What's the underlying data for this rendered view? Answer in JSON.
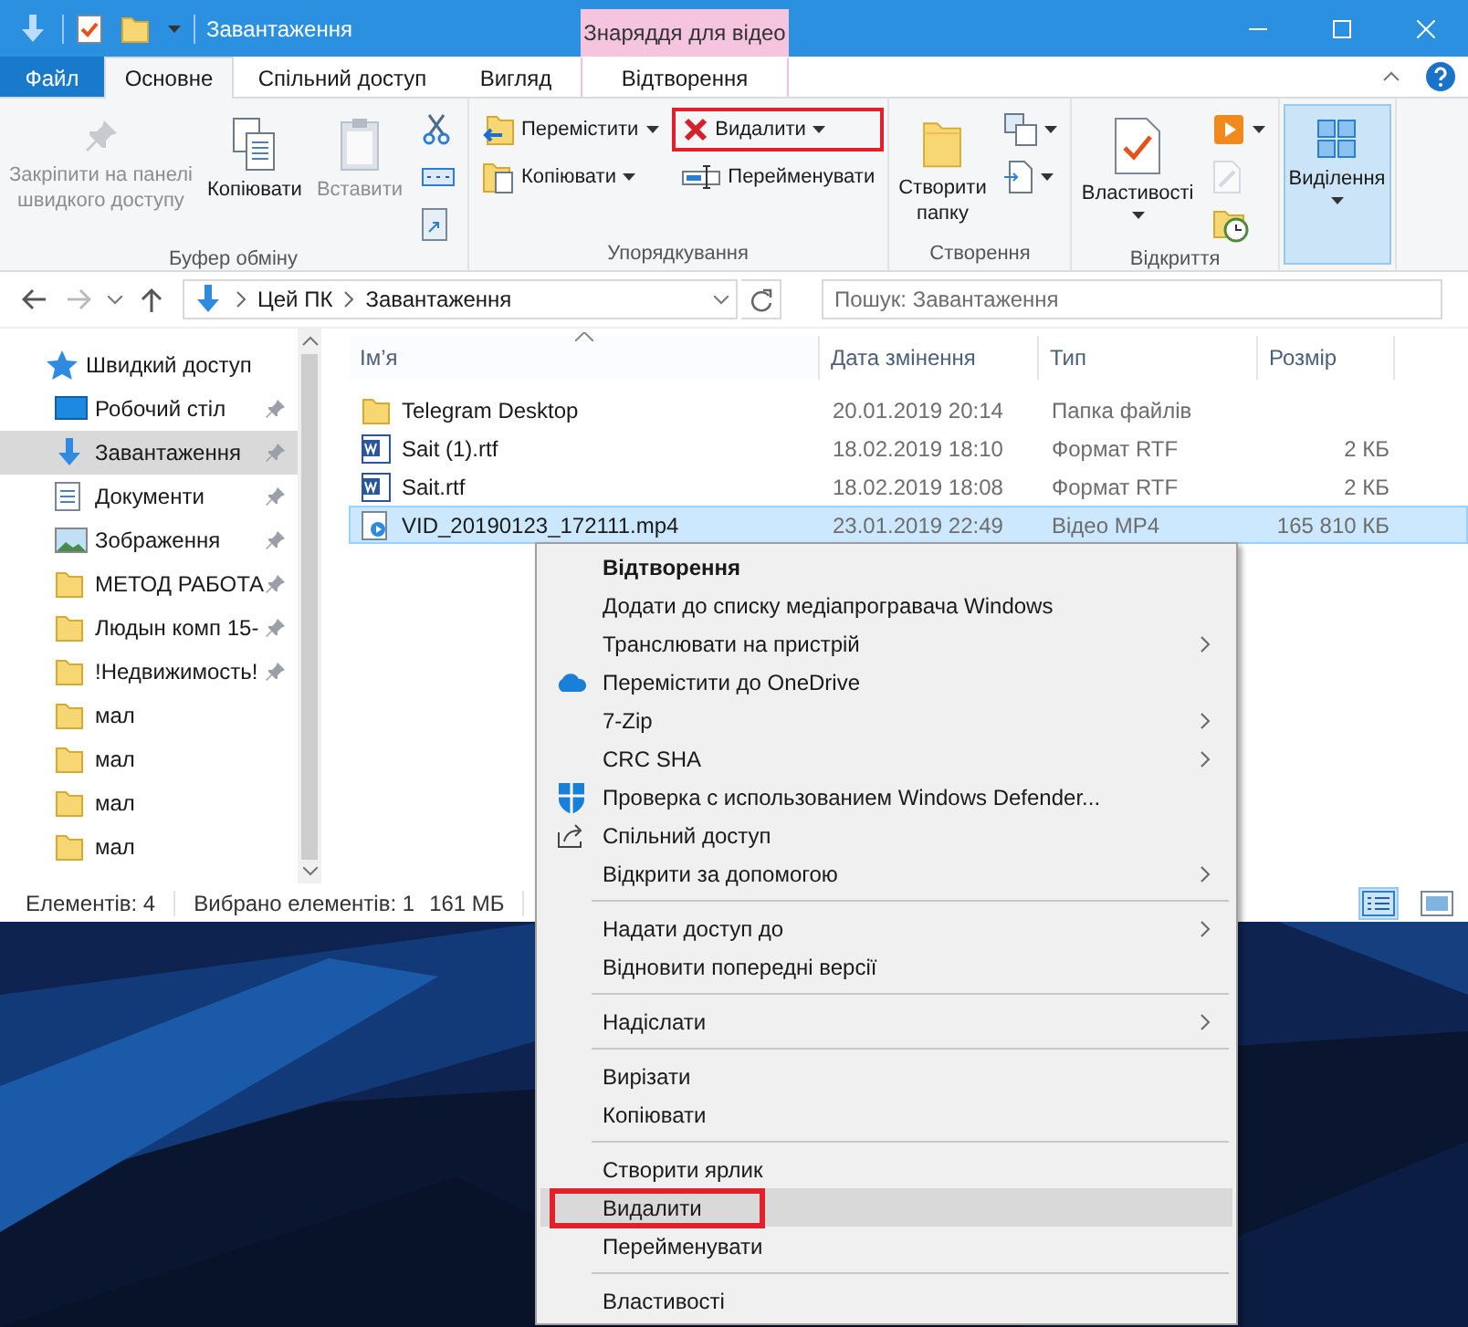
{
  "window": {
    "title": "Завантаження",
    "contextual_group": "Знаряддя для відео"
  },
  "ribbon": {
    "tabs": [
      {
        "label": "Файл",
        "kind": "file",
        "selected": false
      },
      {
        "label": "Основне",
        "kind": "normal",
        "selected": true
      },
      {
        "label": "Спільний доступ",
        "kind": "normal",
        "selected": false
      },
      {
        "label": "Вигляд",
        "kind": "normal",
        "selected": false
      },
      {
        "label": "Відтворення",
        "kind": "contextual",
        "selected": false
      }
    ],
    "groups": [
      {
        "label": "Буфер обміну",
        "items": [
          {
            "kind": "large",
            "label": "Закріпити на панелі\nшвидкого доступу",
            "disabled": true,
            "dropdown": false,
            "highlighted": false,
            "active": false
          },
          {
            "kind": "large",
            "label": "Копіювати",
            "disabled": false,
            "dropdown": false,
            "highlighted": false,
            "active": false
          },
          {
            "kind": "large",
            "label": "Вставити",
            "disabled": true,
            "dropdown": false,
            "highlighted": false,
            "active": false
          },
          {
            "kind": "stack",
            "items": [
              {
                "disabled": false,
                "dropdown": false,
                "highlighted": false
              },
              {
                "disabled": false,
                "dropdown": false,
                "highlighted": false
              },
              {
                "disabled": false,
                "dropdown": false,
                "highlighted": false
              }
            ]
          }
        ]
      },
      {
        "label": "Упорядкування",
        "items": [
          {
            "kind": "stack",
            "items": [
              {
                "label": "Перемістити",
                "disabled": false,
                "dropdown": true,
                "highlighted": false
              },
              {
                "label": "Копіювати",
                "disabled": false,
                "dropdown": true,
                "highlighted": false
              }
            ]
          },
          {
            "kind": "stack",
            "items": [
              {
                "label": "Видалити",
                "disabled": false,
                "dropdown": true,
                "highlighted": true
              },
              {
                "label": "Перейменувати",
                "disabled": false,
                "dropdown": false,
                "highlighted": false
              }
            ]
          }
        ]
      },
      {
        "label": "Створення",
        "items": [
          {
            "kind": "large",
            "label": "Створити\nпапку",
            "disabled": false,
            "dropdown": false,
            "highlighted": false,
            "active": false
          },
          {
            "kind": "stack",
            "items": [
              {
                "disabled": false,
                "dropdown": true,
                "highlighted": false
              },
              {
                "disabled": false,
                "dropdown": true,
                "highlighted": false
              }
            ]
          }
        ]
      },
      {
        "label": "Відкриття",
        "items": [
          {
            "kind": "large",
            "label": "Властивості",
            "disabled": false,
            "dropdown": true,
            "highlighted": false,
            "active": false
          },
          {
            "kind": "stack",
            "items": [
              {
                "disabled": false,
                "dropdown": true,
                "highlighted": false
              },
              {
                "disabled": true,
                "dropdown": false,
                "highlighted": false
              },
              {
                "disabled": false,
                "dropdown": false,
                "highlighted": false
              }
            ]
          }
        ]
      },
      {
        "items": [
          {
            "kind": "large",
            "label": "Виділення",
            "disabled": false,
            "dropdown": true,
            "highlighted": false,
            "active": true
          }
        ]
      }
    ]
  },
  "address": {
    "path": [
      "Цей ПК",
      "Завантаження"
    ]
  },
  "search": {
    "placeholder": "Пошук: Завантаження"
  },
  "navigation": {
    "items": [
      {
        "label": "Швидкий доступ",
        "children": [
          {
            "label": "Робочий стіл",
            "pinned": true,
            "selected": false
          },
          {
            "label": "Завантаження",
            "pinned": true,
            "selected": true
          },
          {
            "label": "Документи",
            "pinned": true,
            "selected": false
          },
          {
            "label": "Зображення",
            "pinned": true,
            "selected": false
          },
          {
            "label": "МЕТОД РАБОТА",
            "pinned": true,
            "selected": false
          },
          {
            "label": "Людын комп 15-",
            "pinned": true,
            "selected": false
          },
          {
            "label": "!Недвижимость!",
            "pinned": true,
            "selected": false
          },
          {
            "label": "мал",
            "pinned": false,
            "selected": false
          },
          {
            "label": "мал",
            "pinned": false,
            "selected": false
          },
          {
            "label": "мал",
            "pinned": false,
            "selected": false
          },
          {
            "label": "мал",
            "pinned": false,
            "selected": false
          }
        ]
      }
    ]
  },
  "table": {
    "columns": [
      {
        "label": "Ім’я",
        "sorted": true
      },
      {
        "label": "Дата змінення",
        "sorted": false
      },
      {
        "label": "Тип",
        "sorted": false
      },
      {
        "label": "Розмір",
        "sorted": false
      }
    ],
    "rows": [
      {
        "name": "Telegram Desktop",
        "date": "20.01.2019 20:14",
        "type": "Папка файлів",
        "selected": false
      },
      {
        "name": "Sait (1).rtf",
        "date": "18.02.2019 18:10",
        "type": "Формат RTF",
        "size": "2 КБ",
        "selected": false
      },
      {
        "name": "Sait.rtf",
        "date": "18.02.2019 18:08",
        "type": "Формат RTF",
        "size": "2 КБ",
        "selected": false
      },
      {
        "name": "VID_20190123_172111.mp4",
        "date": "23.01.2019 22:49",
        "type": "Відео MP4",
        "size": "165 810 КБ",
        "selected": true
      }
    ]
  },
  "status_bar": {
    "count": "Елементів: 4",
    "selection": "Вибрано елементів: 1",
    "size": "161 МБ"
  },
  "context_menu": {
    "sections": [
      [
        {
          "label": "Відтворення",
          "bold": true,
          "submenu": false,
          "hovered": false,
          "highlighted": false
        },
        {
          "label": "Додати до списку медіапрогравача Windows",
          "bold": false,
          "submenu": false,
          "hovered": false,
          "highlighted": false
        },
        {
          "label": "Транслювати на пристрій",
          "bold": false,
          "submenu": true,
          "hovered": false,
          "highlighted": false
        },
        {
          "label": "Перемістити до OneDrive",
          "bold": false,
          "submenu": false,
          "hovered": false,
          "highlighted": false
        },
        {
          "label": "7-Zip",
          "bold": false,
          "submenu": true,
          "hovered": false,
          "highlighted": false
        },
        {
          "label": "CRC SHA",
          "bold": false,
          "submenu": true,
          "hovered": false,
          "highlighted": false
        },
        {
          "label": "Проверка с использованием Windows Defender...",
          "bold": false,
          "submenu": false,
          "hovered": false,
          "highlighted": false
        },
        {
          "label": "Спільний доступ",
          "bold": false,
          "submenu": false,
          "hovered": false,
          "highlighted": false
        },
        {
          "label": "Відкрити за допомогою",
          "bold": false,
          "submenu": true,
          "hovered": false,
          "highlighted": false
        }
      ],
      [
        {
          "label": "Надати доступ до",
          "bold": false,
          "submenu": true,
          "hovered": false,
          "highlighted": false
        },
        {
          "label": "Відновити попередні версії",
          "bold": false,
          "submenu": false,
          "hovered": false,
          "highlighted": false
        }
      ],
      [
        {
          "label": "Надіслати",
          "bold": false,
          "submenu": true,
          "hovered": false,
          "highlighted": false
        }
      ],
      [
        {
          "label": "Вирізати",
          "bold": false,
          "submenu": false,
          "hovered": false,
          "highlighted": false
        },
        {
          "label": "Копіювати",
          "bold": false,
          "submenu": false,
          "hovered": false,
          "highlighted": false
        }
      ],
      [
        {
          "label": "Створити ярлик",
          "bold": false,
          "submenu": false,
          "hovered": false,
          "highlighted": false
        },
        {
          "label": "Видалити",
          "bold": false,
          "submenu": false,
          "hovered": true,
          "highlighted": true
        },
        {
          "label": "Перейменувати",
          "bold": false,
          "submenu": false,
          "hovered": false,
          "highlighted": false
        }
      ],
      [
        {
          "label": "Властивості",
          "bold": false,
          "submenu": false,
          "hovered": false,
          "highlighted": false
        }
      ]
    ]
  }
}
